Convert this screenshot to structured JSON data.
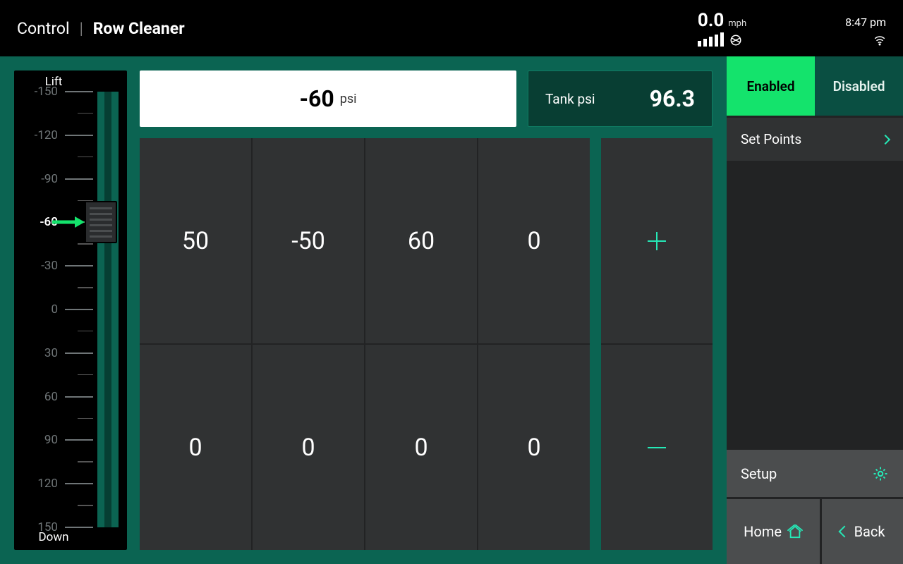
{
  "header": {
    "breadcrumb_root": "Control",
    "breadcrumb_current": "Row Cleaner",
    "speed_value": "0.0",
    "speed_unit": "mph",
    "clock": "8:47 pm"
  },
  "gauge": {
    "title": "Lift",
    "footer": "Down",
    "ticks": [
      "-150",
      "-120",
      "-90",
      "-60",
      "-30",
      "0",
      "30",
      "60",
      "90",
      "120",
      "150"
    ],
    "active_tick": "-60"
  },
  "psi_readout": {
    "value": "-60",
    "unit": "psi"
  },
  "tank": {
    "label": "Tank psi",
    "value": "96.3"
  },
  "rows": {
    "top": [
      "50",
      "-50",
      "60",
      "0"
    ],
    "bottom": [
      "0",
      "0",
      "0",
      "0"
    ]
  },
  "side": {
    "enabled_label": "Enabled",
    "disabled_label": "Disabled",
    "setpoints_label": "Set Points",
    "setup_label": "Setup",
    "home_label": "Home",
    "back_label": "Back"
  }
}
